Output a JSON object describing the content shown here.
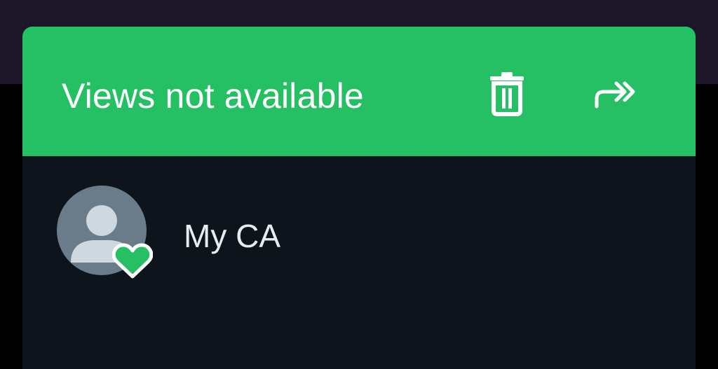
{
  "header": {
    "title": "Views not available",
    "icons": [
      "delete-icon",
      "forward-icon"
    ]
  },
  "contact": {
    "name": "My CA",
    "avatar_icon": "default-person-icon",
    "badge_icon": "heart-icon"
  },
  "colors": {
    "header_bg": "#25c063",
    "sheet_bg": "#0e141b",
    "badge": "#25c063"
  }
}
